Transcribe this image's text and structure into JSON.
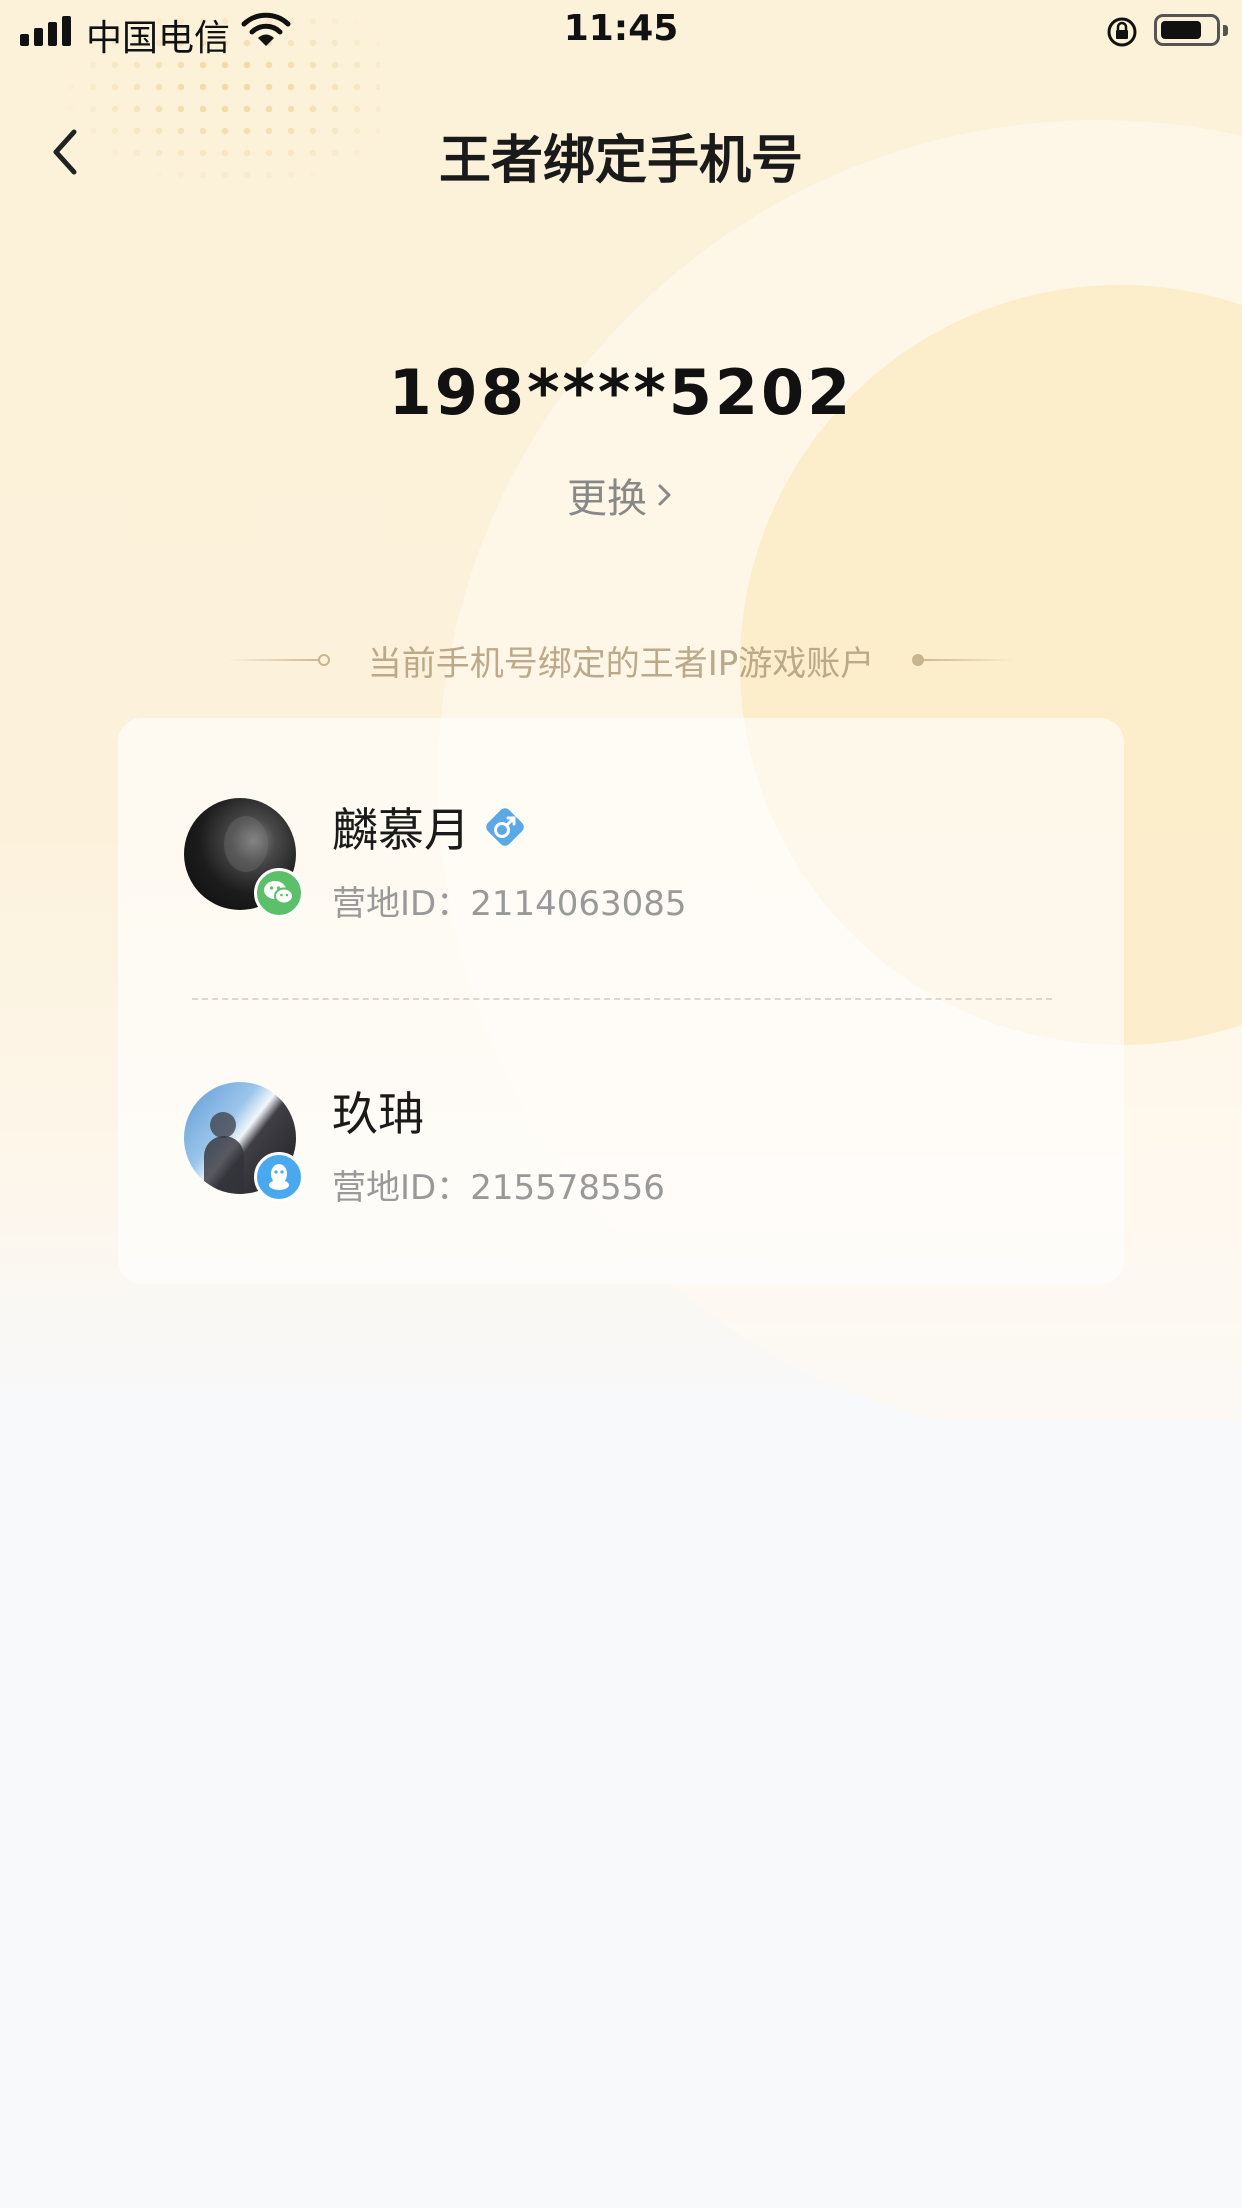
{
  "status_bar": {
    "carrier": "中国电信",
    "time": "11:45"
  },
  "nav": {
    "title": "王者绑定手机号"
  },
  "phone": {
    "number": "198****5202",
    "change_label": "更换"
  },
  "section": {
    "title": "当前手机号绑定的王者IP游戏账户"
  },
  "accounts": [
    {
      "name": "麟慕月",
      "id_label": "营地ID：",
      "id": "2114063085",
      "platform": "wechat-icon",
      "gender": "male-icon",
      "gender_color": "#5aa8e6"
    },
    {
      "name": "玖珃",
      "id_label": "营地ID：",
      "id": "215578556",
      "platform": "qq-icon"
    }
  ],
  "colors": {
    "background": "#f8f9fb",
    "header_gradient": "#fcf2d9",
    "wechat_green": "#5cbf6a",
    "qq_blue": "#4aa8ef",
    "section_text": "#bba989"
  }
}
